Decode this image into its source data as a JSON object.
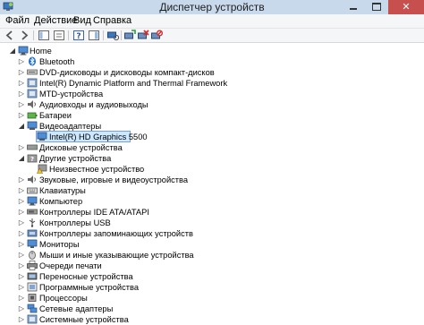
{
  "window": {
    "title": "Диспетчер устройств"
  },
  "menu": {
    "items": [
      "Файл",
      "Действие",
      "Вид",
      "Справка"
    ]
  },
  "tree": {
    "root": "Home",
    "categories": [
      "Bluetooth",
      "DVD-дисководы и дисководы компакт-дисков",
      "Intel(R) Dynamic Platform and Thermal Framework",
      "MTD-устройства",
      "Аудиовходы и аудиовыходы",
      "Батареи",
      "Видеоадаптеры",
      "Intel(R) HD Graphics 5500",
      "Дисковые устройства",
      "Другие устройства",
      "Неизвестное устройство",
      "Звуковые, игровые и видеоустройства",
      "Клавиатуры",
      "Компьютер",
      "Контроллеры IDE ATA/ATAPI",
      "Контроллеры USB",
      "Контроллеры запоминающих устройств",
      "Мониторы",
      "Мыши и иные указывающие устройства",
      "Очереди печати",
      "Переносные устройства",
      "Программные устройства",
      "Процессоры",
      "Сетевые адаптеры",
      "Системные устройства"
    ]
  },
  "colors": {
    "selection": "#cce8ff",
    "titlebar": "#c9d9ec",
    "close": "#c7504f"
  }
}
